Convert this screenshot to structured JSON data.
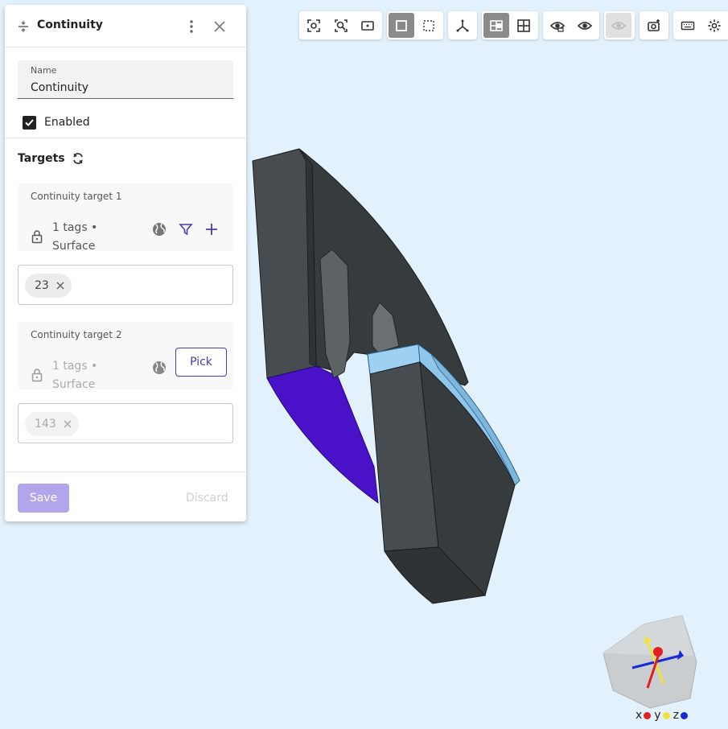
{
  "panel": {
    "title": "Continuity",
    "name_label": "Name",
    "name_value": "Continuity",
    "enabled_label": "Enabled",
    "enabled_checked": true,
    "targets_title": "Targets",
    "targets": [
      {
        "title": "Continuity target 1",
        "tags": "1 tags •",
        "type": "Surface",
        "chip": "23",
        "active": true
      },
      {
        "title": "Continuity target 2",
        "tags": "1 tags •",
        "type": "Surface",
        "chip": "143",
        "active": false,
        "pick_label": "Pick"
      }
    ],
    "save_label": "Save",
    "discard_label": "Discard"
  },
  "toolbar": {
    "groups": [
      {
        "buttons": [
          "zoom-to-selection-icon",
          "zoom-fit-icon",
          "zoom-window-icon"
        ]
      },
      {
        "buttons": [
          "select-solid-icon",
          "select-box-icon"
        ]
      },
      {
        "buttons": [
          "axes-icon"
        ]
      },
      {
        "buttons": [
          "shaded-view-icon",
          "grid-view-icon"
        ]
      },
      {
        "buttons": [
          "hide-icon",
          "show-icon"
        ]
      },
      {
        "buttons": [
          "eye-disabled-icon"
        ]
      },
      {
        "buttons": [
          "screenshot-icon"
        ]
      },
      {
        "buttons": [
          "keyboard-icon",
          "settings-icon"
        ]
      }
    ]
  },
  "axes": {
    "x": "x",
    "y": "y",
    "z": "z"
  },
  "colors": {
    "background": "#e3f1fc",
    "accent": "#4a3cad",
    "save_disabled": "#b3a5ec",
    "selected_face": "#4a12c8",
    "highlight_face": "#8fc6ea",
    "body_dark": "#3a3f42",
    "x_axis": "#e02020",
    "y_axis": "#f0e040",
    "z_axis": "#1a28d8"
  }
}
